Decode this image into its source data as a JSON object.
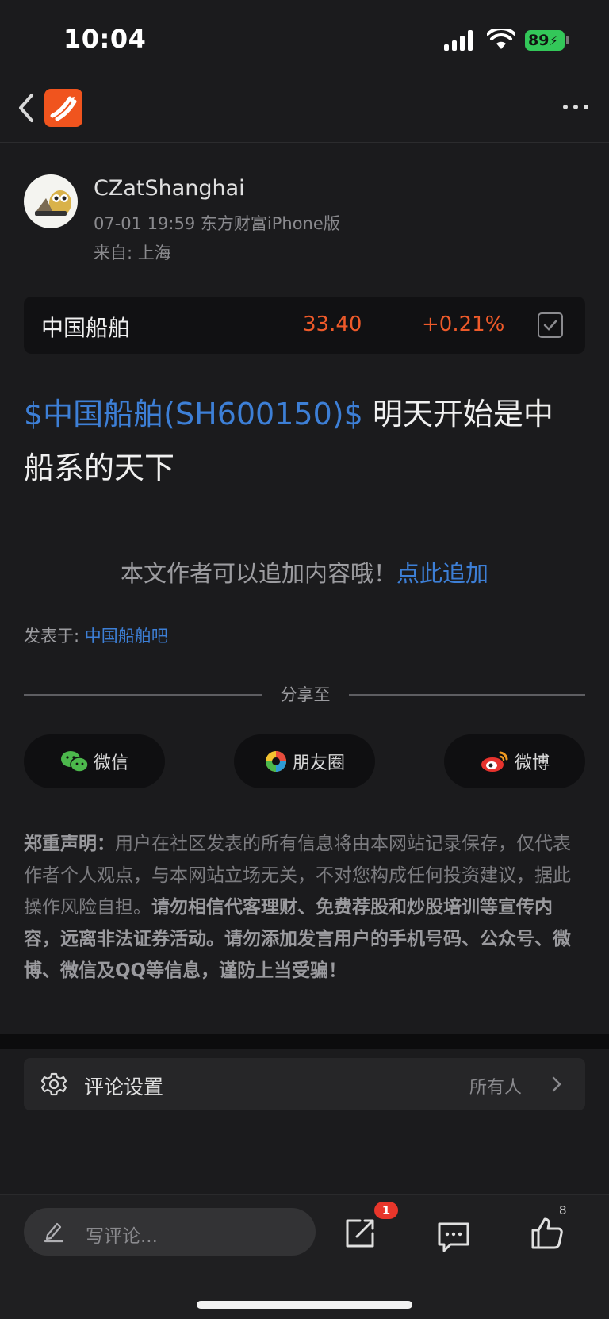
{
  "status_bar": {
    "time": "10:04",
    "battery": "89"
  },
  "author": {
    "name": "CZatShanghai",
    "meta": "07-01 19:59 东方财富iPhone版",
    "location": "来自: 上海"
  },
  "stock": {
    "name": "中国船舶",
    "price": "33.40",
    "change": "+0.21%",
    "color": "#ee5a2a"
  },
  "post": {
    "tag": "$中国船舶(SH600150)$",
    "text": "明天开始是中船系的天下"
  },
  "append": {
    "text": "本文作者可以追加内容哦！",
    "link": "点此追加"
  },
  "board": {
    "label": "发表于: ",
    "link": "中国船舶吧"
  },
  "share": {
    "label": "分享至",
    "buttons": [
      {
        "label": "微信",
        "icon": "wechat-icon"
      },
      {
        "label": "朋友圈",
        "icon": "moments-icon"
      },
      {
        "label": "微博",
        "icon": "weibo-icon"
      }
    ]
  },
  "disclaimer": {
    "title": "郑重声明：",
    "body": "用户在社区发表的所有信息将由本网站记录保存，仅代表作者个人观点，与本网站立场无关，不对您构成任何投资建议，据此操作风险自担。",
    "warning": "请勿相信代客理财、免费荐股和炒股培训等宣传内容，远离非法证券活动。请勿添加发言用户的手机号码、公众号、微博、微信及QQ等信息，谨防上当受骗！"
  },
  "comment_settings": {
    "label": "评论设置",
    "value": "所有人"
  },
  "bottom_bar": {
    "input_placeholder": "写评论...",
    "share_badge": "1",
    "like_count": "8"
  },
  "colors": {
    "accent_blue": "#3d7fd6",
    "stock_up": "#ee5a2a",
    "brand": "#f0541e"
  }
}
